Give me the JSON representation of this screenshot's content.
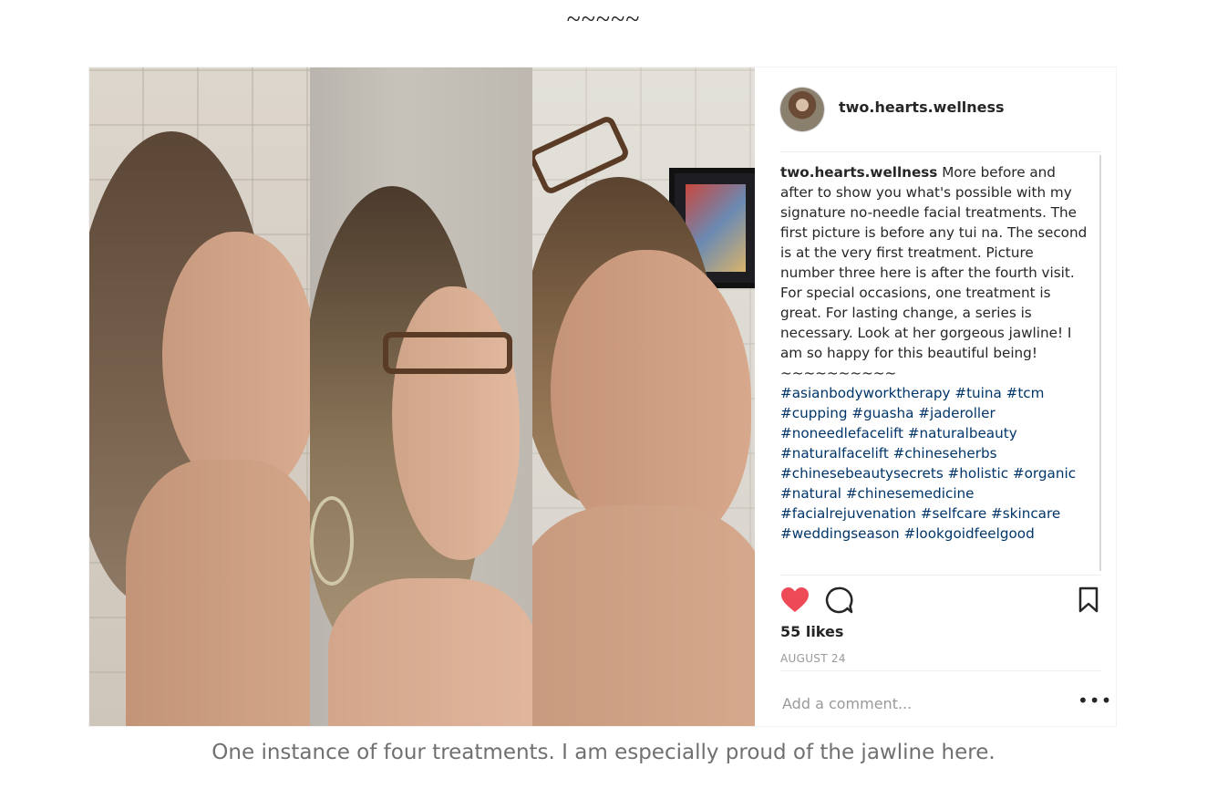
{
  "page": {
    "divider": "~~~~~",
    "figure_caption": "One instance of four treatments.  I am especially proud of the jawline here."
  },
  "post": {
    "username": "two.hearts.wellness",
    "caption_user": "two.hearts.wellness",
    "caption_text": "More before and after to show you what's possible with my signature no-needle facial treatments. The first picture is before any tui na. The second is at the very first treatment. Picture number three here is after the fourth visit. For special occasions, one treatment is great. For lasting change, a series is necessary. Look at her gorgeous jawline! I am so happy for this beautiful being!",
    "separator": "~~~~~~~~~~",
    "hashtags": "#asianbodyworktherapy #tuina #tcm #cupping #guasha #jaderoller #noneedlefacelift #naturalbeauty #naturalfacelift #chineseherbs #chinesebeautysecrets #holistic #organic #natural #chinesemedicine #facialrejuvenation #selfcare #skincare #weddingseason #lookgoidfeelgood",
    "likes": "55 likes",
    "date": "AUGUST 24",
    "comment_placeholder": "Add a comment...",
    "more_icon": "•••",
    "liked": true
  },
  "icons": {
    "heart": "heart-icon",
    "comment": "comment-icon",
    "bookmark": "bookmark-icon",
    "more": "more-icon"
  },
  "colors": {
    "heart": "#ed4956",
    "hashtag": "#003569",
    "text": "#262626",
    "muted": "#999999"
  }
}
